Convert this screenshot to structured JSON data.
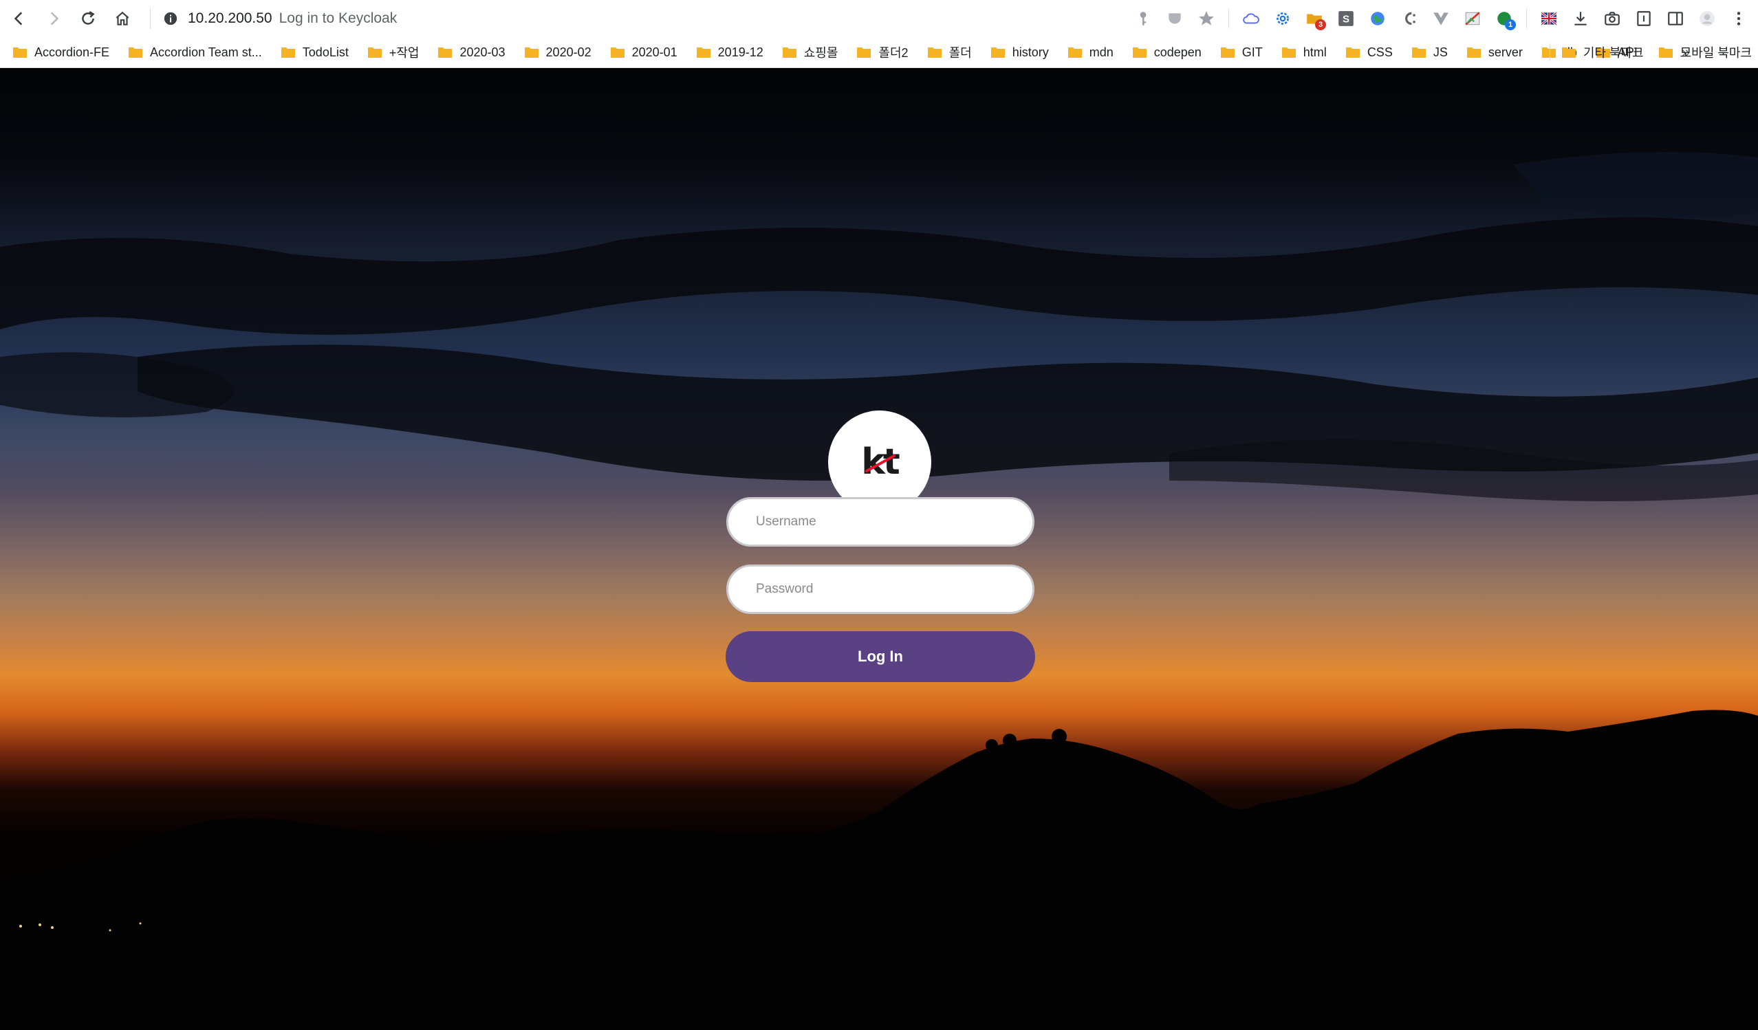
{
  "browser": {
    "address": {
      "host": "10.20.200.50",
      "page_title": "Log in to Keycloak"
    },
    "extensions": [
      {
        "icon": "key-icon"
      },
      {
        "icon": "pocket-icon"
      },
      {
        "icon": "bookmark-star-icon"
      },
      {
        "icon": "cloud-icon"
      },
      {
        "icon": "gear-extension-icon"
      },
      {
        "icon": "folder-extension-icon",
        "badge": "3",
        "badge_color": "#d93025"
      },
      {
        "icon": "s-extension-icon"
      },
      {
        "icon": "globe-extension-icon"
      },
      {
        "icon": "c-extension-icon"
      },
      {
        "icon": "vue-devtools-icon"
      },
      {
        "icon": "no-image-extension-icon"
      },
      {
        "icon": "green-circle-extension-icon",
        "badge": "1",
        "badge_color": "#1a73e8"
      },
      {
        "icon": "flag-extension-icon"
      },
      {
        "icon": "download-icon"
      },
      {
        "icon": "camera-icon"
      },
      {
        "icon": "reader-icon"
      },
      {
        "icon": "side-panel-icon"
      },
      {
        "icon": "profile-avatar-icon"
      },
      {
        "icon": "menu-icon"
      }
    ],
    "bookmarks": [
      "Accordion-FE",
      "Accordion Team st...",
      "TodoList",
      "+작업",
      "2020-03",
      "2020-02",
      "2020-01",
      "2019-12",
      "쇼핑몰",
      "폴더2",
      "폴더",
      "history",
      "mdn",
      "codepen",
      "GIT",
      "html",
      "CSS",
      "JS",
      "server",
      "db",
      "API"
    ],
    "bookmarks_overflow": "»",
    "bookmarks_right": [
      "기타 북마크",
      "모바일 북마크"
    ],
    "folder_color": "#f5b324"
  },
  "login": {
    "logo_text": "kt",
    "username_placeholder": "Username",
    "password_placeholder": "Password",
    "login_button": "Log In",
    "button_color": "#5a4183"
  }
}
